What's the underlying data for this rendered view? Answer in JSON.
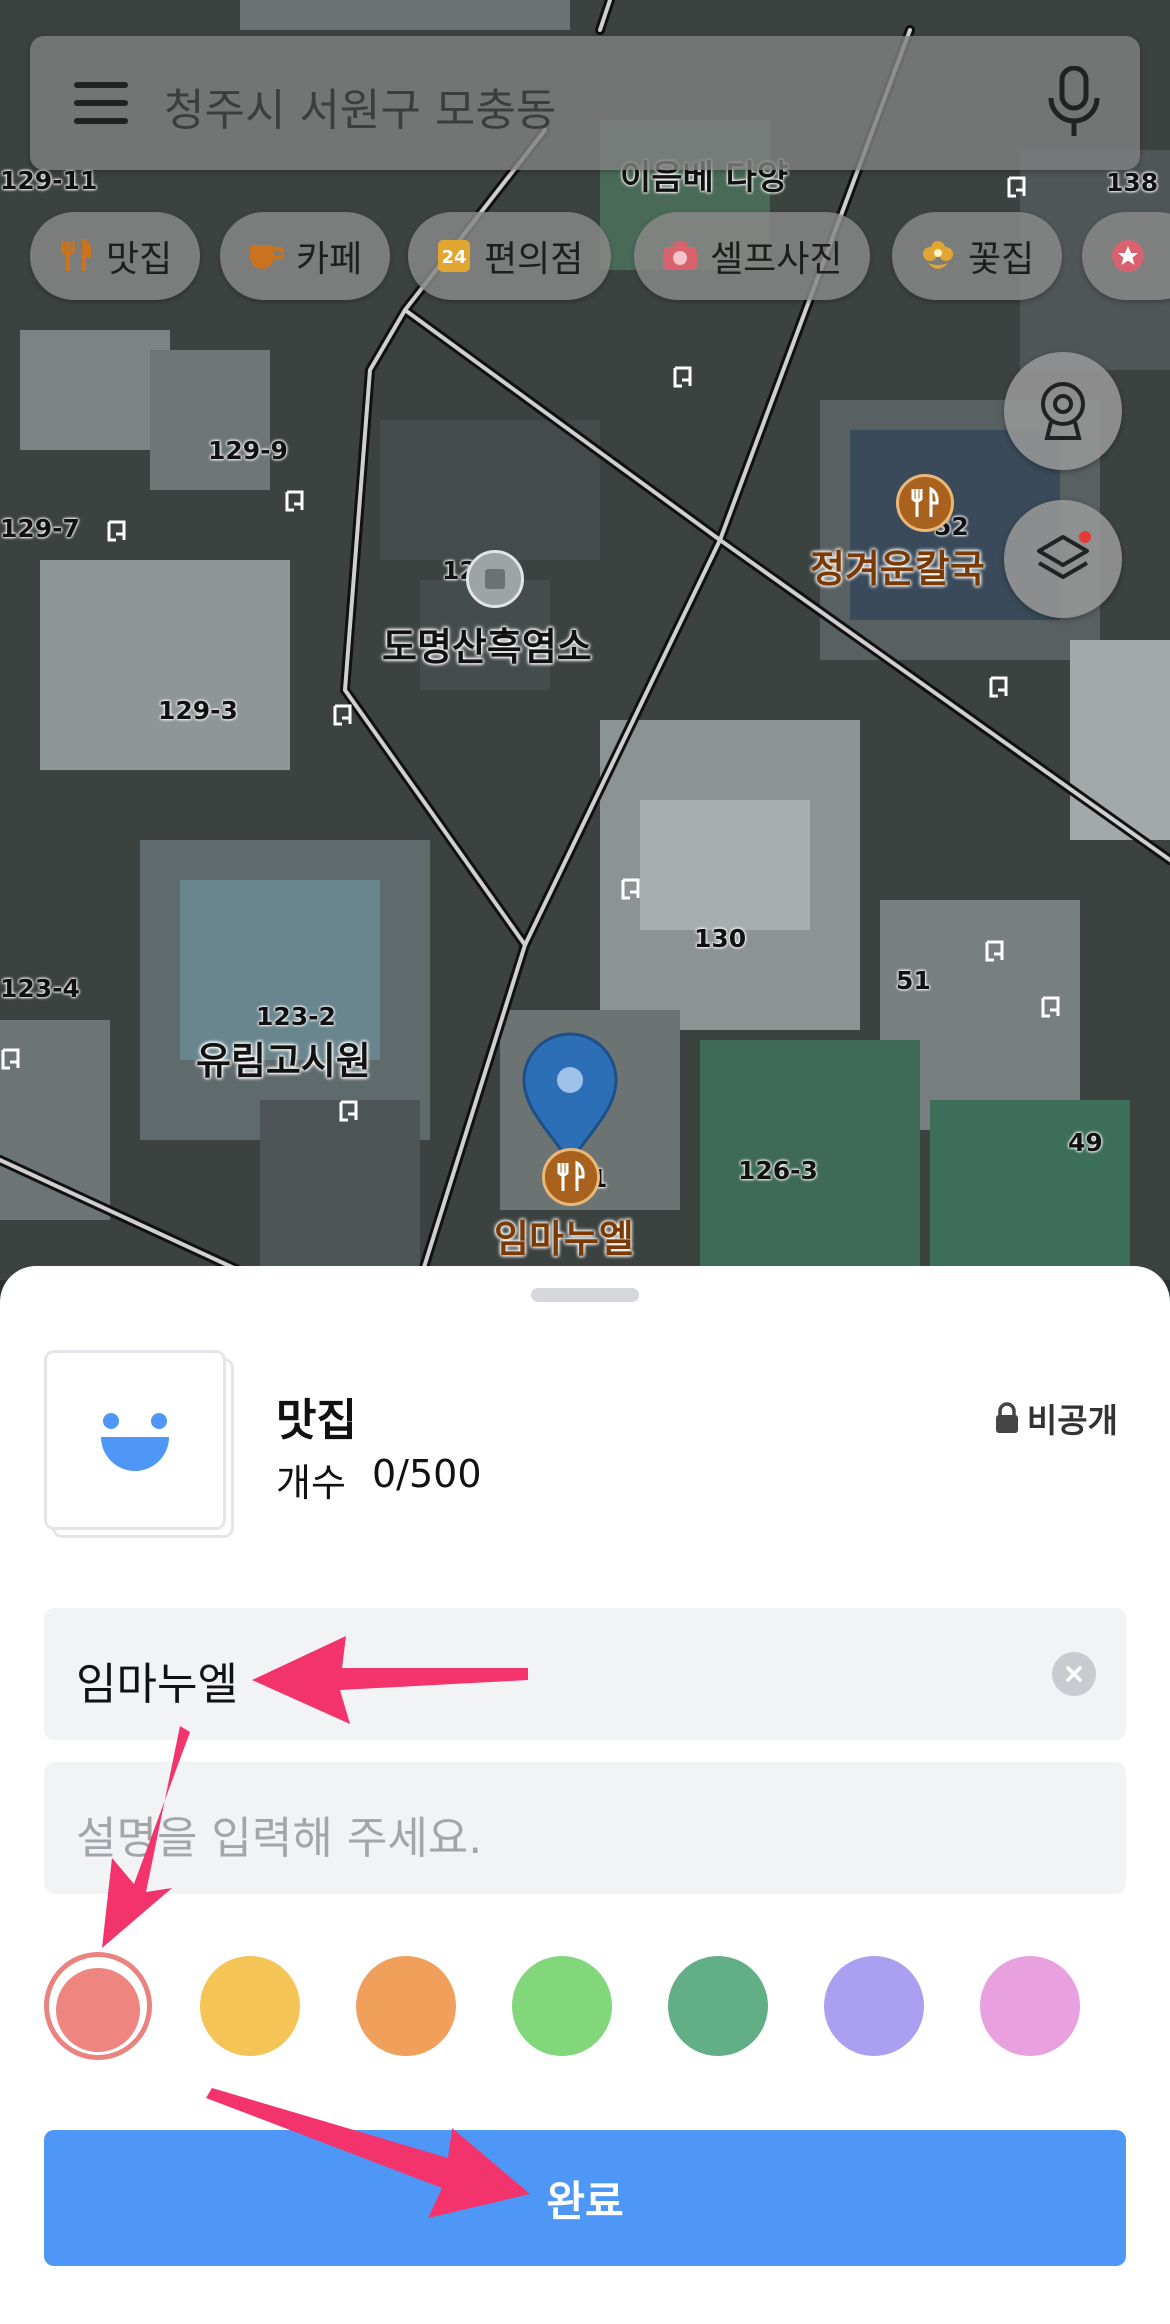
{
  "search": {
    "query": "청주시 서원구 모충동"
  },
  "chips": [
    {
      "label": "맛집",
      "icon": "fork-knife-icon",
      "color": "#c8731f"
    },
    {
      "label": "카페",
      "icon": "coffee-cup-icon",
      "color": "#c8731f"
    },
    {
      "label": "편의점",
      "icon": "convenience-store-24-icon",
      "color": "#e1a531"
    },
    {
      "label": "셀프사진",
      "icon": "camera-icon",
      "color": "#d8626e"
    },
    {
      "label": "꽃집",
      "icon": "flower-icon",
      "color": "#e1a531"
    }
  ],
  "map": {
    "lot_numbers": [
      "129-11",
      "138",
      "129-9",
      "129-7",
      "129-3",
      "123-4",
      "123-2",
      "130",
      "51",
      "49",
      "126-3",
      "12",
      "52",
      "1"
    ],
    "places": [
      "도명산흑염소",
      "정겨운칼국",
      "유림고시원",
      "임마누엘"
    ],
    "partial_label": "이음베 다양"
  },
  "sheet": {
    "list_title": "맛집",
    "count_label": "개수",
    "count_value": "0/500",
    "privacy": "비공개",
    "name_value": "임마누엘",
    "description_placeholder": "설명을 입력해 주세요.",
    "colors": [
      "#ee8580",
      "#f4c457",
      "#f0a05a",
      "#82d77a",
      "#62ae86",
      "#aa9ff1",
      "#e8a0de"
    ],
    "selected_color_index": 0,
    "done_label": "완료"
  },
  "annotations": {
    "arrow_color": "#f2336c"
  }
}
